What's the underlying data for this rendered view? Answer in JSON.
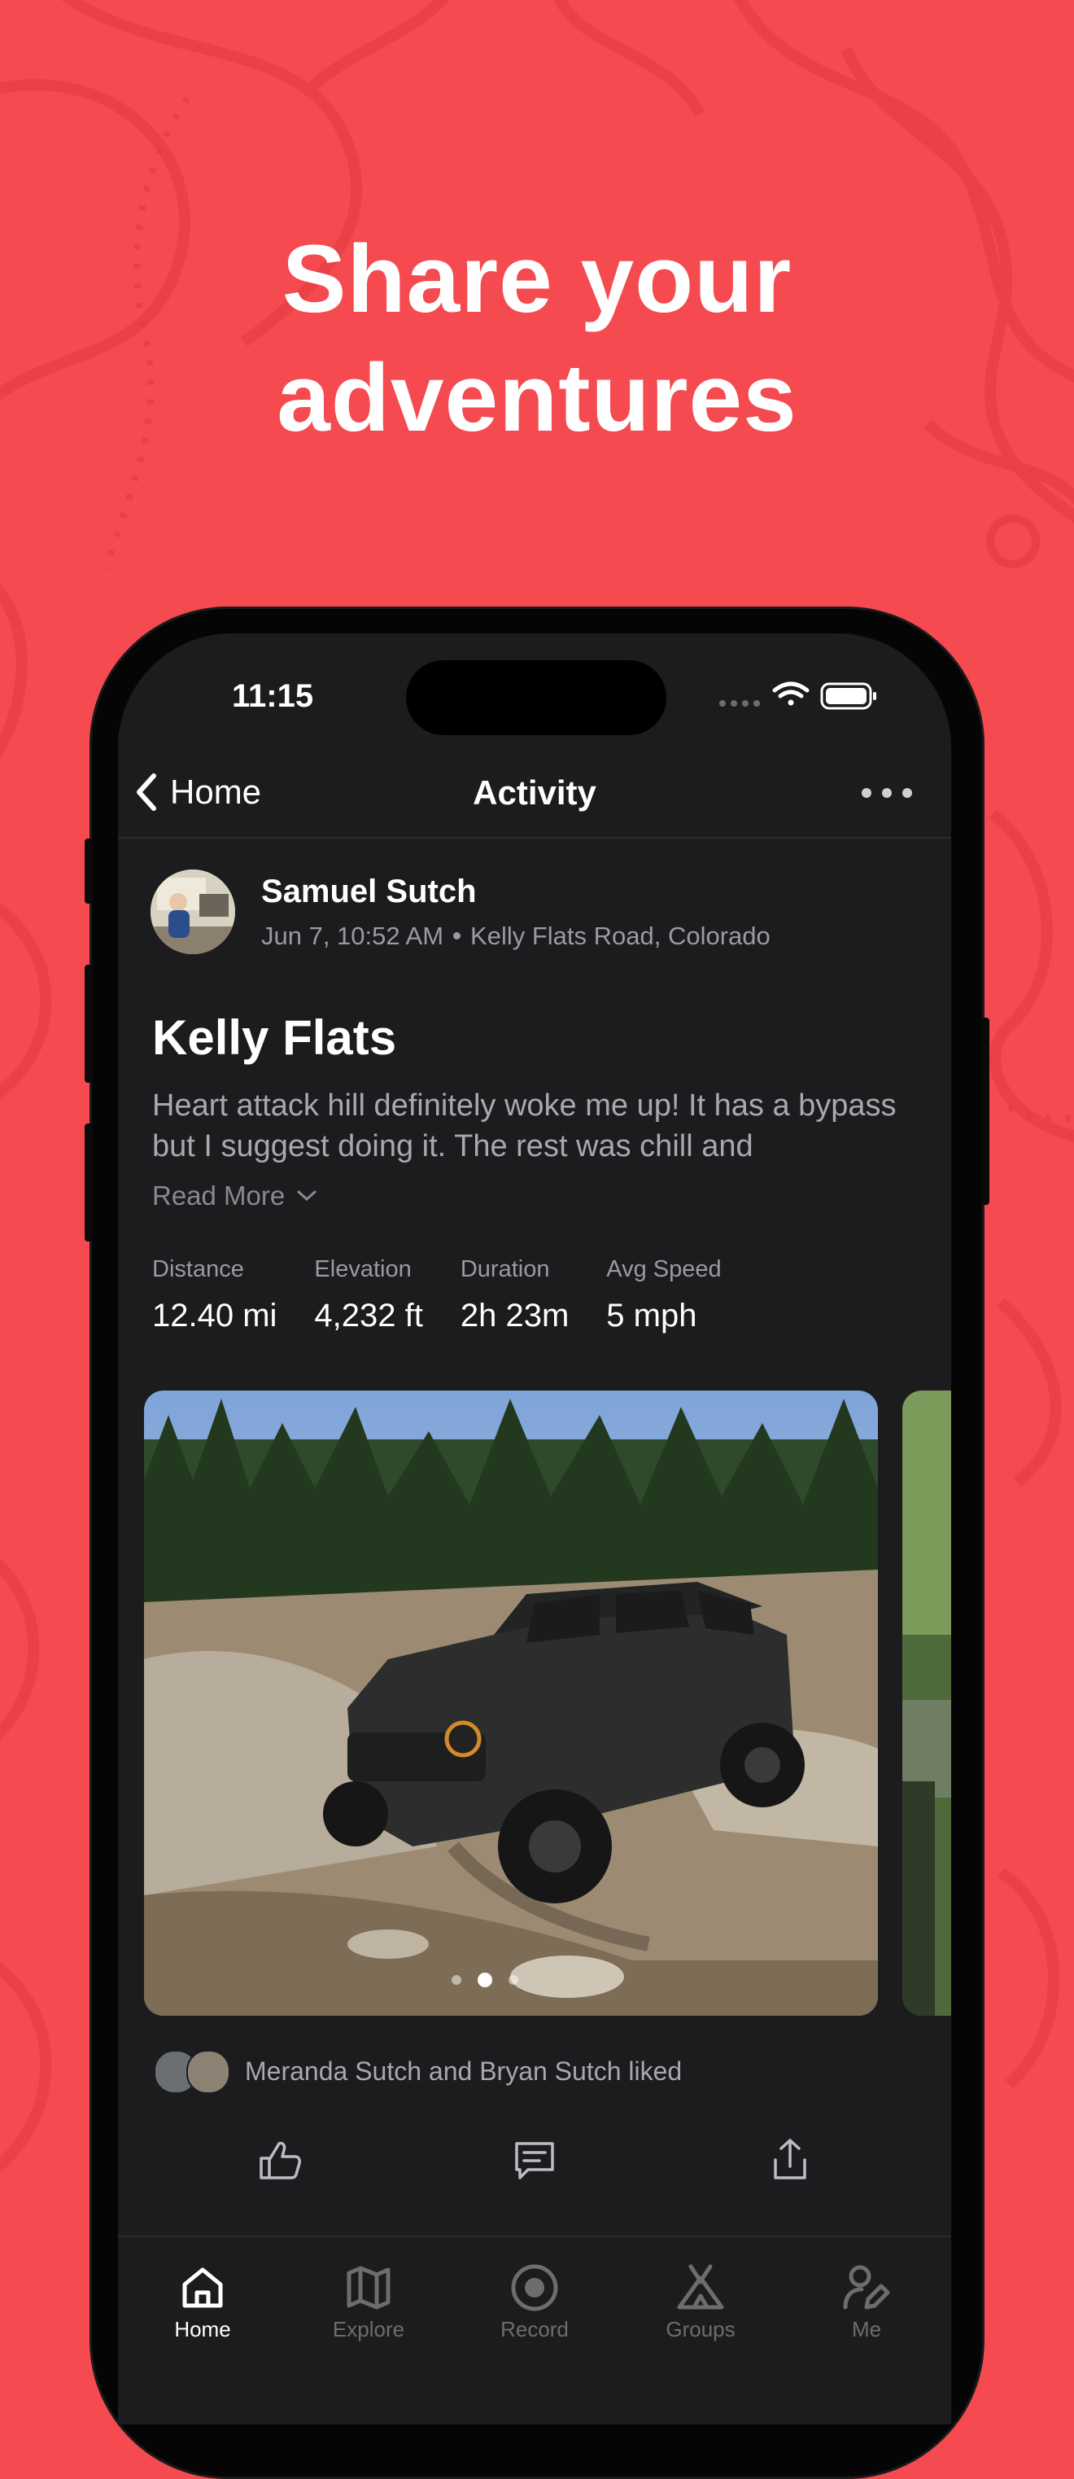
{
  "headline": {
    "line1": "Share your",
    "line2": "adventures"
  },
  "colors": {
    "background": "#F54A4F",
    "screen": "#1C1C1E",
    "secondary_text": "#9B9B9F"
  },
  "status_bar": {
    "time": "11:15"
  },
  "nav": {
    "back_label": "Home",
    "title": "Activity",
    "back_icon": "chevron-left-icon",
    "more_icon": "ellipsis-icon"
  },
  "post": {
    "author": "Samuel Sutch",
    "timestamp": "Jun 7, 10:52 AM",
    "location": "Kelly Flats Road, Colorado",
    "title": "Kelly Flats",
    "description": "Heart attack hill definitely woke me up! It has a bypass but I suggest doing it. The rest was chill and",
    "read_more": "Read More",
    "stats": [
      {
        "label": "Distance",
        "value": "12.40 mi"
      },
      {
        "label": "Elevation",
        "value": "4,232 ft"
      },
      {
        "label": "Duration",
        "value": "2h 23m"
      },
      {
        "label": "Avg Speed",
        "value": "5 mph"
      }
    ],
    "photo_page": {
      "current": 2,
      "total": 3
    },
    "likes_text": "Meranda Sutch and Bryan Sutch liked"
  },
  "actions": [
    {
      "name": "like-button",
      "icon": "thumbs-up-icon"
    },
    {
      "name": "comment-button",
      "icon": "comment-icon"
    },
    {
      "name": "share-button",
      "icon": "share-icon"
    }
  ],
  "tabs": [
    {
      "label": "Home",
      "icon": "home-icon",
      "active": true
    },
    {
      "label": "Explore",
      "icon": "map-icon",
      "active": false
    },
    {
      "label": "Record",
      "icon": "record-icon",
      "active": false
    },
    {
      "label": "Groups",
      "icon": "tent-icon",
      "active": false
    },
    {
      "label": "Me",
      "icon": "profile-edit-icon",
      "active": false
    }
  ]
}
